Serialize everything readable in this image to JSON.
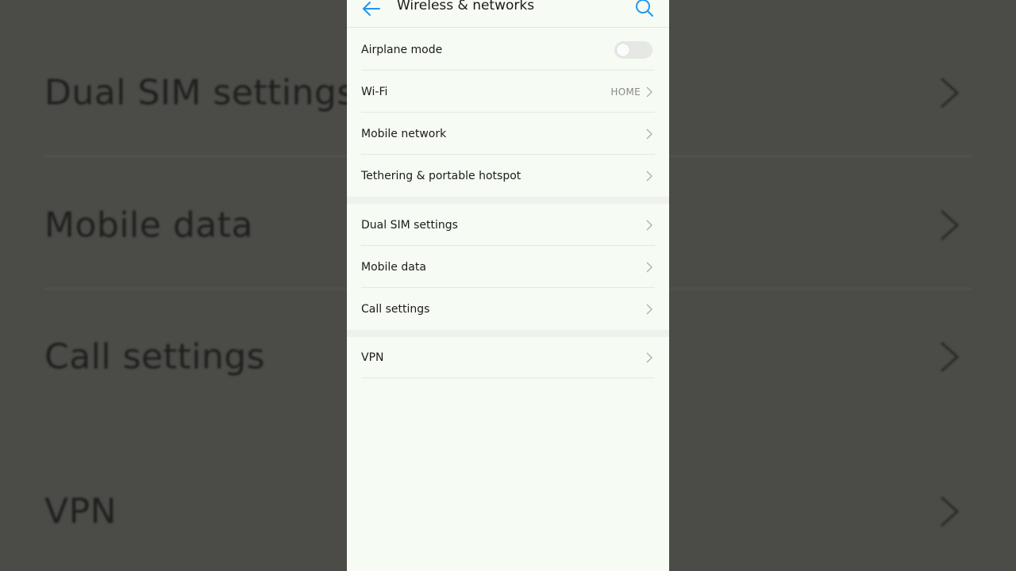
{
  "background": {
    "rows": [
      {
        "label": "Dual SIM settings"
      },
      {
        "label": "Mobile data"
      },
      {
        "label": "Call settings"
      },
      {
        "label": "VPN"
      }
    ]
  },
  "header": {
    "title": "Wireless & networks",
    "back_icon": "arrow-left-icon",
    "search_icon": "search-icon"
  },
  "groups": [
    {
      "items": [
        {
          "label": "Airplane mode",
          "control": "toggle",
          "on": false
        },
        {
          "label": "Wi-Fi",
          "value": "HOME"
        },
        {
          "label": "Mobile network"
        },
        {
          "label": "Tethering & portable hotspot"
        }
      ]
    },
    {
      "items": [
        {
          "label": "Dual SIM settings"
        },
        {
          "label": "Mobile data"
        },
        {
          "label": "Call settings"
        }
      ]
    },
    {
      "items": [
        {
          "label": "VPN"
        }
      ]
    }
  ],
  "colors": {
    "accent": "#2196f3",
    "panel_bg": "#f6fbf3",
    "text": "#1c1c1c",
    "secondary_text": "#8a8a8a"
  }
}
